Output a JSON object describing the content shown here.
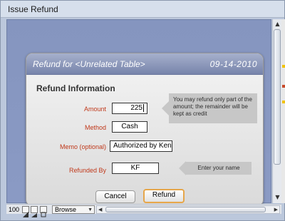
{
  "window": {
    "title": "Issue Refund"
  },
  "dialog": {
    "header_left": "Refund for <Unrelated Table>",
    "header_date": "09-14-2010",
    "section_title": "Refund Information"
  },
  "form": {
    "amount_label": "Amount",
    "amount_value": "225",
    "method_label": "Method",
    "method_value": "Cash",
    "memo_label": "Memo (optional)",
    "memo_value": "Authorized by Ken",
    "refunded_by_label": "Refunded By",
    "refunded_by_value": "KF"
  },
  "hints": {
    "amount_hint": "You may refund only part of the amount; the remainder will be kept as credit",
    "refunded_by_hint": "Enter your name"
  },
  "buttons": {
    "cancel": "Cancel",
    "refund": "Refund"
  },
  "statusbar": {
    "zoom": "100",
    "mode": "Browse"
  },
  "colors": {
    "label_red": "#c0391b",
    "accent_orange": "#e6a64a",
    "header_blue": "#7784ab"
  },
  "icons": {
    "scroll_up": "up-arrow-icon",
    "scroll_down": "down-arrow-icon",
    "zoom_out": "zoom-out-icon",
    "zoom_in": "zoom-in-icon",
    "layout": "layout-icon"
  }
}
